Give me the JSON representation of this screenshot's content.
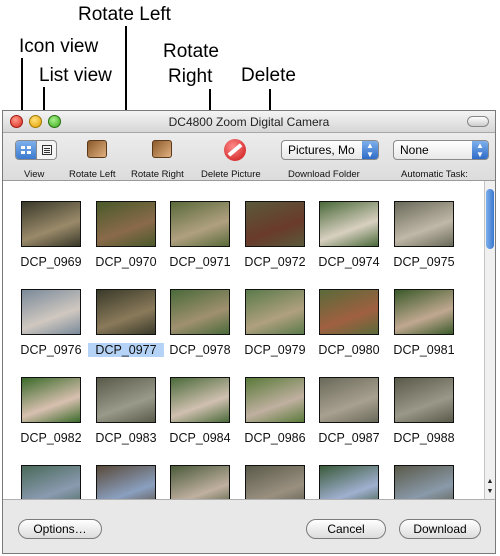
{
  "callouts": {
    "icon_view": "Icon view",
    "list_view": "List view",
    "rotate_left": "Rotate Left",
    "rotate_right_1": "Rotate",
    "rotate_right_2": "Right",
    "delete": "Delete"
  },
  "window": {
    "title": "DC4800 Zoom Digital Camera"
  },
  "toolbar": {
    "view_label": "View",
    "rotate_left_label": "Rotate Left",
    "rotate_right_label": "Rotate Right",
    "delete_label": "Delete Picture",
    "download_folder_label": "Download Folder",
    "automatic_task_label": "Automatic Task:",
    "download_folder_value": "Pictures, Mo",
    "automatic_task_value": "None"
  },
  "thumbnails": [
    {
      "name": "DCP_0969",
      "colors": [
        "#3a3a2a",
        "#9a8a6a"
      ]
    },
    {
      "name": "DCP_0970",
      "colors": [
        "#4a5a2a",
        "#8a6a4a"
      ]
    },
    {
      "name": "DCP_0971",
      "colors": [
        "#5a6a3a",
        "#b0a080"
      ]
    },
    {
      "name": "DCP_0972",
      "colors": [
        "#5a5a3a",
        "#6a3a2a"
      ]
    },
    {
      "name": "DCP_0974",
      "colors": [
        "#4a6a3a",
        "#d8d0c0"
      ]
    },
    {
      "name": "DCP_0975",
      "colors": [
        "#6a6a5a",
        "#c0b8a8"
      ]
    },
    {
      "name": "DCP_0976",
      "colors": [
        "#7a8a9a",
        "#d0c8c0"
      ]
    },
    {
      "name": "DCP_0977",
      "colors": [
        "#3a3a2a",
        "#8a7a5a"
      ]
    },
    {
      "name": "DCP_0978",
      "colors": [
        "#4a6a3a",
        "#a09070"
      ]
    },
    {
      "name": "DCP_0979",
      "colors": [
        "#5a7a4a",
        "#b0a080"
      ]
    },
    {
      "name": "DCP_0980",
      "colors": [
        "#5a6a3a",
        "#a06040"
      ]
    },
    {
      "name": "DCP_0981",
      "colors": [
        "#3a5a2a",
        "#c0a890"
      ]
    },
    {
      "name": "DCP_0982",
      "colors": [
        "#3a6a2a",
        "#d8c0b0"
      ]
    },
    {
      "name": "DCP_0983",
      "colors": [
        "#5a5a4a",
        "#9a9a8a"
      ]
    },
    {
      "name": "DCP_0984",
      "colors": [
        "#4a6a3a",
        "#d0c0b0"
      ]
    },
    {
      "name": "DCP_0986",
      "colors": [
        "#5a7a3a",
        "#c0b0a0"
      ]
    },
    {
      "name": "DCP_0987",
      "colors": [
        "#6a6a5a",
        "#a8a090"
      ]
    },
    {
      "name": "DCP_0988",
      "colors": [
        "#5a5a4a",
        "#9a9888"
      ]
    },
    {
      "name": "",
      "colors": [
        "#4a6a5a",
        "#8a9ab0"
      ]
    },
    {
      "name": "",
      "colors": [
        "#5a4a3a",
        "#8aa0c0"
      ]
    },
    {
      "name": "",
      "colors": [
        "#4a5a3a",
        "#c0b0a0"
      ]
    },
    {
      "name": "",
      "colors": [
        "#5a5a4a",
        "#9a9080"
      ]
    },
    {
      "name": "",
      "colors": [
        "#3a5a3a",
        "#a0b0d0"
      ]
    },
    {
      "name": "",
      "colors": [
        "#5a5a4a",
        "#8a9aaa"
      ]
    }
  ],
  "selected_index": 7,
  "buttons": {
    "options": "Options…",
    "cancel": "Cancel",
    "download": "Download"
  }
}
